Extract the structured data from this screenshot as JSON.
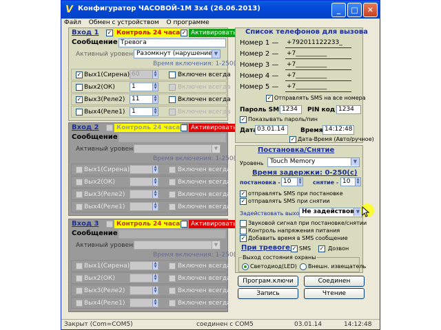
{
  "window": {
    "title": "Конфигуратор ЧАСОВОЙ-1М 3х4 (26.06.2013)",
    "menu": [
      "Файл",
      "Обмен с устройством",
      "О программе"
    ]
  },
  "zones": [
    {
      "name": "Вход 1",
      "enabled": true,
      "ctrl24_label": "Контроль 24 часа",
      "ctrl24_checked": true,
      "activate_label": "Активировать",
      "activate_checked": true,
      "message_label": "Сообщение",
      "message_value": "Тревога",
      "active_level_label": "Активный уровень",
      "active_level_value": "Разомкнут (нарушение)",
      "time_range": "Время включения: 1-250(с)",
      "outputs": [
        {
          "label": "Вых1(Сирена)",
          "checked": true,
          "value": "60",
          "value_disabled": true,
          "always_label": "Включен всегда",
          "always_checked": false,
          "always_disabled": false
        },
        {
          "label": "Вых2(ОК)",
          "checked": false,
          "value": "1",
          "value_disabled": false,
          "always_label": "Включен всегда",
          "always_checked": false,
          "always_disabled": true
        },
        {
          "label": "Вых3(Реле2)",
          "checked": true,
          "value": "11",
          "value_disabled": false,
          "always_label": "Включен всегда",
          "always_checked": false,
          "always_disabled": false
        },
        {
          "label": "Вых4(Реле1)",
          "checked": false,
          "value": "1",
          "value_disabled": false,
          "always_label": "Включен всегда",
          "always_checked": false,
          "always_disabled": true
        }
      ]
    },
    {
      "name": "Вход 2",
      "enabled": false,
      "ctrl24_label": "Контроль 24 часа",
      "ctrl24_checked": false,
      "activate_label": "Активировать",
      "activate_checked": false,
      "message_label": "Сообщение",
      "message_value": "",
      "active_level_label": "Активный уровень",
      "active_level_value": "",
      "time_range": "Время включения: 1-250(с)",
      "outputs": [
        {
          "label": "Вых1(Сирена)",
          "checked": false,
          "value": "",
          "always_label": "Включен всегда"
        },
        {
          "label": "Вых2(ОК)",
          "checked": false,
          "value": "",
          "always_label": "Включен всегда"
        },
        {
          "label": "Вых3(Реле2)",
          "checked": false,
          "value": "",
          "always_label": "Включен всегда"
        },
        {
          "label": "Вых4(Реле1)",
          "checked": false,
          "value": "",
          "always_label": "Включен всегда"
        }
      ]
    },
    {
      "name": "Вход 3",
      "enabled": false,
      "ctrl24_label": "Контроль 24 часа",
      "ctrl24_checked": false,
      "activate_label": "Активировать",
      "activate_checked": false,
      "message_label": "Сообщение",
      "message_value": "",
      "active_level_label": "Активный уровень",
      "active_level_value": "",
      "time_range": "Время включения: 1-250(с)",
      "outputs": [
        {
          "label": "Вых1(Сирена)",
          "checked": false,
          "value": "",
          "always_label": "Включен всегда"
        },
        {
          "label": "Вых2(ОК)",
          "checked": false,
          "value": "",
          "always_label": "Включен всегда"
        },
        {
          "label": "Вых3(Реле2)",
          "checked": false,
          "value": "",
          "always_label": "Включен всегда"
        },
        {
          "label": "Вых4(Реле1)",
          "checked": false,
          "value": "",
          "always_label": "Включен всегда"
        }
      ]
    }
  ],
  "phones": {
    "title": "Список телефонов для вызова",
    "numbers": [
      {
        "label": "Номер 1 —",
        "value": "+792011122233_"
      },
      {
        "label": "Номер 2 —",
        "value": "+7__________"
      },
      {
        "label": "Номер 3 —",
        "value": "+7__________"
      },
      {
        "label": "Номер 4 —",
        "value": "+7__________"
      },
      {
        "label": "Номер 5 —",
        "value": "+7__________"
      }
    ],
    "sms_all_label": "Отправлять SMS на все номера",
    "sms_all_checked": true,
    "sms_password_label": "Пароль SMS",
    "sms_password_value": "1234",
    "pin_label": "PIN код",
    "pin_value": "1234",
    "show_password_label": "Показывать пароль/пин",
    "show_password_checked": true,
    "date_label": "Дата",
    "date_value": "03.01.14",
    "time_label": "Время",
    "time_value": "14:12:48",
    "auto_dt_label": "Дата-Время (Авто/ручное)",
    "auto_dt_checked": true
  },
  "arming": {
    "title": "Постановка/Снятие",
    "level_label": "Уровень",
    "level_value": "Touch Memory",
    "delay_title": "Время задержки: 0-250(с)",
    "arm_label": "постановка -",
    "arm_value": "10",
    "disarm_label": "снятие -",
    "disarm_value": "10",
    "sms_arm_label": "отправлять SMS при постановке",
    "sms_arm_checked": true,
    "sms_disarm_label": "отправлять SMS при снятии",
    "sms_disarm_checked": true,
    "output_label": "Задействовать выход",
    "output_value": "Не задействовать",
    "sound_label": "Звуковой сигнал при постановке/снятии",
    "sound_checked": false,
    "power_label": "Контроль напряжения питания",
    "power_checked": false,
    "add_time_label": "Добавить время в SMS сообщение",
    "add_time_checked": true,
    "alarm_label": "При тревоге -",
    "alarm_sms_label": "SMS",
    "alarm_sms_checked": true,
    "alarm_call_label": "Дозвон",
    "alarm_call_checked": true,
    "state_output_title": "Выход состояния охраны",
    "state_led_label": "Светодиод(LED)",
    "state_led_selected": true,
    "state_ext_label": "Внешн. извещатель",
    "state_ext_selected": false
  },
  "buttons": {
    "program_keys": "Програм.ключи",
    "connect": "Соединен",
    "write": "Запись",
    "read": "Чтение"
  },
  "status": {
    "port": "Закрыт (Com=COM5)",
    "link": "соединен с COM5",
    "date": "03.01.14",
    "time": "14:12:48"
  },
  "colors": {
    "titlebar": "#0448d8",
    "panel": "#d8dbbd",
    "disabled_panel": "#9a9a9a",
    "header_blue": "#1b2f9e",
    "alarm_yellow": "#ffff00",
    "activate_green": "#10a018",
    "activate_red": "#e00000"
  }
}
